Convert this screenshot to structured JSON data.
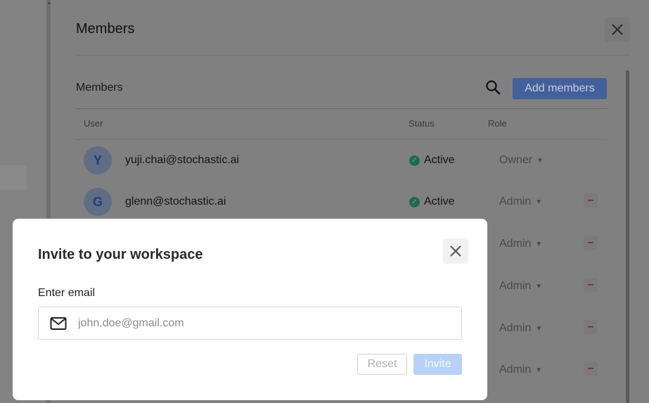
{
  "members_modal": {
    "title": "Members",
    "close_icon": "close-icon",
    "section_title": "Members",
    "search_icon": "search-icon",
    "add_members_label": "Add members",
    "columns": [
      "User",
      "Status",
      "Role"
    ],
    "rows": [
      {
        "initial": "Y",
        "email": "yuji.chai@stochastic.ai",
        "status": "Active",
        "role": "Owner",
        "removable": false
      },
      {
        "initial": "G",
        "email": "glenn@stochastic.ai",
        "status": "Active",
        "role": "Admin",
        "removable": true
      },
      {
        "initial": "",
        "email": "",
        "status": "",
        "role": "Admin",
        "removable": true
      },
      {
        "initial": "",
        "email": "",
        "status": "",
        "role": "Admin",
        "removable": true
      },
      {
        "initial": "",
        "email": "",
        "status": "",
        "role": "Admin",
        "removable": true
      },
      {
        "initial": "",
        "email": "",
        "status": "",
        "role": "Admin",
        "removable": true
      }
    ],
    "remove_glyph": "–"
  },
  "invite_dialog": {
    "title": "Invite to your workspace",
    "close_icon": "close-icon",
    "email_label": "Enter email",
    "email_placeholder": "john.doe@gmail.com",
    "email_value": "",
    "mail_icon": "mail-icon",
    "reset_label": "Reset",
    "invite_label": "Invite"
  },
  "colors": {
    "accent": "#44609a",
    "invite_disabled": "#b7d2f6",
    "status_active": "#1f6b4b",
    "remove": "#8f1f1f"
  }
}
